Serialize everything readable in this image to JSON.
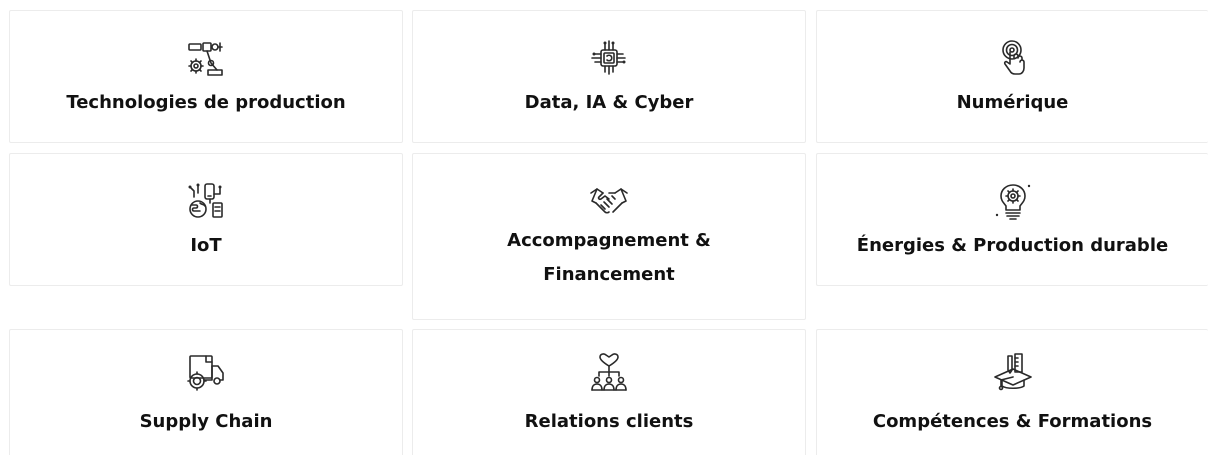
{
  "categories": [
    {
      "label": "Technologies de production",
      "icon": "robot-arm-icon"
    },
    {
      "label": "Data, IA & Cyber",
      "icon": "ai-chip-icon"
    },
    {
      "label": "Numérique",
      "icon": "touch-finger-icon"
    },
    {
      "label": "IoT",
      "icon": "iot-devices-icon"
    },
    {
      "label": "Accompagnement & Financement",
      "icon": "handshake-icon"
    },
    {
      "label": "Énergies & Production durable",
      "icon": "gear-bulb-icon"
    },
    {
      "label": "Supply Chain",
      "icon": "delivery-truck-icon"
    },
    {
      "label": "Relations clients",
      "icon": "customer-network-icon"
    },
    {
      "label": "Compétences & Formations",
      "icon": "graduation-cap-icon"
    }
  ],
  "colors": {
    "text": "#111111",
    "icon": "#2a2a2a",
    "border": "#ececec",
    "background": "#ffffff"
  }
}
